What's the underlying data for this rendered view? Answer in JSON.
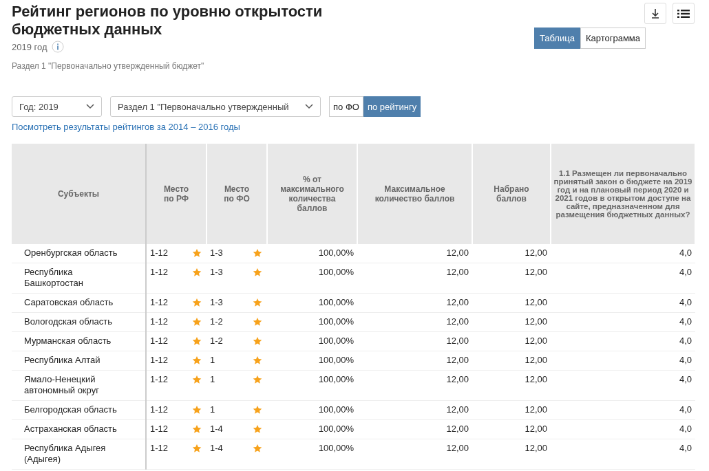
{
  "title": "Рейтинг регионов по уровню открытости бюджетных данных",
  "year": "2019 год",
  "section": "Раздел 1 \"Первоначально утвержденный бюджет\"",
  "view_tabs": [
    {
      "label": "Таблица",
      "selected": true
    },
    {
      "label": "Картограмма",
      "selected": false
    }
  ],
  "filters": [
    {
      "value": "Год: 2019"
    },
    {
      "value": "Раздел 1 \"Первоначально утвержденный"
    }
  ],
  "sort_tabs": [
    {
      "label": "по ФО",
      "selected": false
    },
    {
      "label": "по рейтингу",
      "selected": true
    }
  ],
  "archive_link": "Посмотреть результаты рейтингов за 2014 – 2016 годы",
  "table": {
    "columns": [
      {
        "label": "Субъекты",
        "kind": "name"
      },
      {
        "label": "Место по РФ",
        "kind": "rank"
      },
      {
        "label": "Место по ФО",
        "kind": "rank"
      },
      {
        "label": "% от максимального количества баллов",
        "kind": "number"
      },
      {
        "label": "Максимальное количество баллов",
        "kind": "number"
      },
      {
        "label": "Набрано баллов",
        "kind": "number"
      },
      {
        "label": "1.1 Размещен ли первоначально принятый закон о бюджете на 2019 год и на плановый период 2020 и 2021 годов в открытом доступе на сайте, предназначенном для размещения бюджетных данных?",
        "kind": "number"
      }
    ],
    "rows": [
      {
        "cells": [
          "Оренбургская область",
          "1-12",
          "1-3",
          "100,00%",
          "12,00",
          "12,00",
          "4,0"
        ]
      },
      {
        "cells": [
          "Республика Башкортостан",
          "1-12",
          "1-3",
          "100,00%",
          "12,00",
          "12,00",
          "4,0"
        ]
      },
      {
        "cells": [
          "Саратовская область",
          "1-12",
          "1-3",
          "100,00%",
          "12,00",
          "12,00",
          "4,0"
        ]
      },
      {
        "cells": [
          "Вологодская область",
          "1-12",
          "1-2",
          "100,00%",
          "12,00",
          "12,00",
          "4,0"
        ]
      },
      {
        "cells": [
          "Мурманская область",
          "1-12",
          "1-2",
          "100,00%",
          "12,00",
          "12,00",
          "4,0"
        ]
      },
      {
        "cells": [
          "Республика Алтай",
          "1-12",
          "1",
          "100,00%",
          "12,00",
          "12,00",
          "4,0"
        ]
      },
      {
        "cells": [
          "Ямало-Ненецкий автономный округ",
          "1-12",
          "1",
          "100,00%",
          "12,00",
          "12,00",
          "4,0"
        ]
      },
      {
        "cells": [
          "Белгородская область",
          "1-12",
          "1",
          "100,00%",
          "12,00",
          "12,00",
          "4,0"
        ]
      },
      {
        "cells": [
          "Астраханская область",
          "1-12",
          "1-4",
          "100,00%",
          "12,00",
          "12,00",
          "4,0"
        ]
      },
      {
        "cells": [
          "Республика Адыгея (Адыгея)",
          "1-12",
          "1-4",
          "100,00%",
          "12,00",
          "12,00",
          "4,0"
        ]
      }
    ]
  }
}
